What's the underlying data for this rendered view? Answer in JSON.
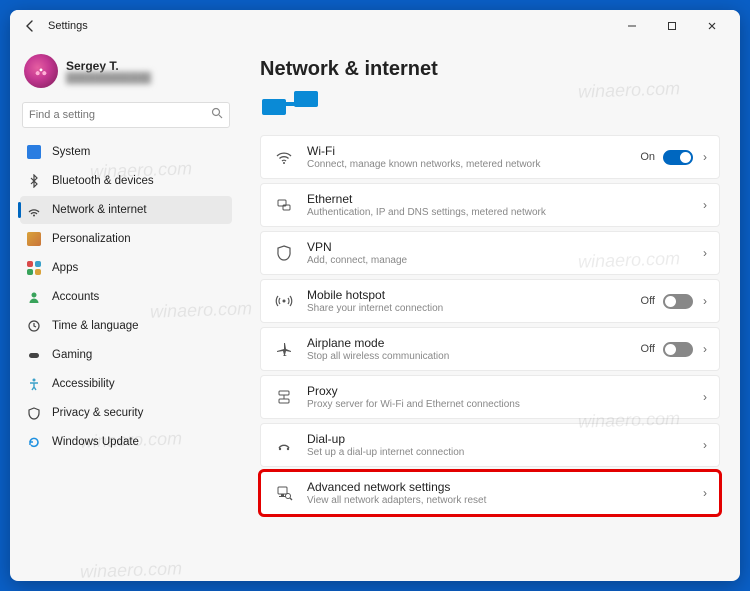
{
  "window": {
    "title": "Settings"
  },
  "user": {
    "name": "Sergey T."
  },
  "search": {
    "placeholder": "Find a setting"
  },
  "sidebar": {
    "items": [
      {
        "label": "System",
        "icon": "system",
        "color": "#2a7de1"
      },
      {
        "label": "Bluetooth & devices",
        "icon": "bluetooth",
        "color": "#3a3a3a"
      },
      {
        "label": "Network & internet",
        "icon": "network",
        "color": "#3a3a3a",
        "active": true
      },
      {
        "label": "Personalization",
        "icon": "personalization",
        "color": "#c98a3a"
      },
      {
        "label": "Apps",
        "icon": "apps",
        "color": "#d94a4a"
      },
      {
        "label": "Accounts",
        "icon": "accounts",
        "color": "#39a35b"
      },
      {
        "label": "Time & language",
        "icon": "time",
        "color": "#3a3a3a"
      },
      {
        "label": "Gaming",
        "icon": "gaming",
        "color": "#3a3a3a"
      },
      {
        "label": "Accessibility",
        "icon": "accessibility",
        "color": "#3aa0c9"
      },
      {
        "label": "Privacy & security",
        "icon": "privacy",
        "color": "#3a3a3a"
      },
      {
        "label": "Windows Update",
        "icon": "update",
        "color": "#1e90e0"
      }
    ]
  },
  "page": {
    "title": "Network & internet"
  },
  "cards": [
    {
      "icon": "wifi",
      "title": "Wi-Fi",
      "sub": "Connect, manage known networks, metered network",
      "status": "On",
      "toggle": "on"
    },
    {
      "icon": "ethernet",
      "title": "Ethernet",
      "sub": "Authentication, IP and DNS settings, metered network"
    },
    {
      "icon": "vpn",
      "title": "VPN",
      "sub": "Add, connect, manage"
    },
    {
      "icon": "hotspot",
      "title": "Mobile hotspot",
      "sub": "Share your internet connection",
      "status": "Off",
      "toggle": "off"
    },
    {
      "icon": "airplane",
      "title": "Airplane mode",
      "sub": "Stop all wireless communication",
      "status": "Off",
      "toggle": "off"
    },
    {
      "icon": "proxy",
      "title": "Proxy",
      "sub": "Proxy server for Wi-Fi and Ethernet connections"
    },
    {
      "icon": "dialup",
      "title": "Dial-up",
      "sub": "Set up a dial-up internet connection"
    },
    {
      "icon": "advanced",
      "title": "Advanced network settings",
      "sub": "View all network adapters, network reset",
      "highlight": true
    }
  ],
  "watermark": "winaero.com"
}
